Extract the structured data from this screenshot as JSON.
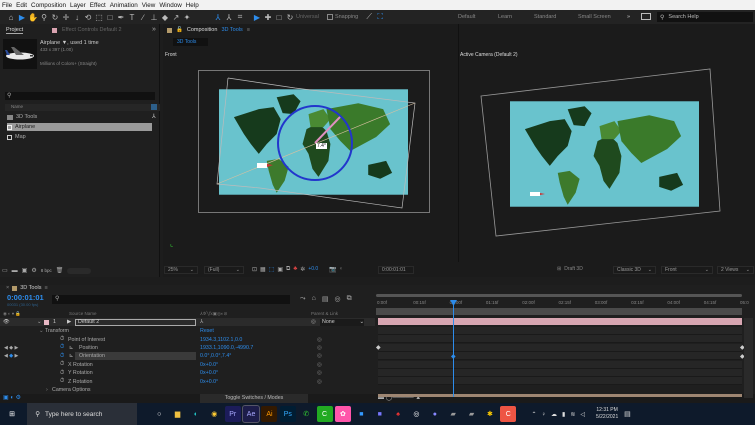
{
  "menu": [
    "File",
    "Edit",
    "Composition",
    "Layer",
    "Effect",
    "Animation",
    "View",
    "Window",
    "Help"
  ],
  "toolbar": {
    "axis_mode": "Universal",
    "snapping": "Snapping",
    "workspaces": [
      "Default",
      "Learn",
      "Standard",
      "Small Screen"
    ],
    "more": "»",
    "search_placeholder": "Search Help"
  },
  "project": {
    "tab": "Project",
    "effect_tab": "Effect Controls Default 2",
    "item_name": "Airplane ▼",
    "item_used": ", used 1 time",
    "item_dims": "433 x 397 (1.00)",
    "item_colors": "Millions of Colors+ (Straight)",
    "col_name": "Name",
    "items": [
      "3D Tools",
      "Airplane",
      "Map"
    ],
    "bpc": "8 bpc"
  },
  "comp": {
    "tab_prefix": "Composition",
    "tab_name": "3D Tools",
    "breadcrumb": "3D Tools",
    "left_view": "Front",
    "right_view": "Active Camera (Default 2)",
    "angle_label": "7.4°",
    "zoom": "25%",
    "resolution": "(Full)",
    "exposure": "+0.0",
    "timecode": "0:00:01:01",
    "draft": "Draft 3D",
    "renderer": "Classic 3D",
    "view": "Front",
    "views": "2 Views"
  },
  "timeline": {
    "tab": "3D Tools",
    "timecode": "0:00:01:01",
    "frames": "00031 (30.00 fps)",
    "col_source": "Source Name",
    "col_parent": "Parent & Link",
    "layer_num": "1",
    "layer_name": "Default 2",
    "parent": "None",
    "props": [
      {
        "name": "Transform",
        "value": "Reset"
      },
      {
        "name": "Point of Interest",
        "value": "1934.3,1102.1,0.0"
      },
      {
        "name": "Position",
        "value": "1933.1,1090.0,-4990.7"
      },
      {
        "name": "Orientation",
        "value": "0.0°,0.0°,7.4°"
      },
      {
        "name": "X Rotation",
        "value": "0x+0.0°"
      },
      {
        "name": "Y Rotation",
        "value": "0x+0.0°"
      },
      {
        "name": "Z Rotation",
        "value": "0x+0.0°"
      },
      {
        "name": "Camera Options",
        "value": ""
      }
    ],
    "ruler": [
      "0:00f",
      "00:15f",
      "01:00f",
      "01:15f",
      "02:00f",
      "02:15f",
      "03:00f",
      "03:15f",
      "04:00f",
      "04:15f",
      "05:0"
    ],
    "toggle": "Toggle Switches / Modes"
  },
  "taskbar": {
    "search": "Type here to search",
    "apps": [
      "Pr",
      "Ae",
      "Ai",
      "Ps"
    ],
    "time": "12:31 PM",
    "date": "5/22/2021"
  }
}
